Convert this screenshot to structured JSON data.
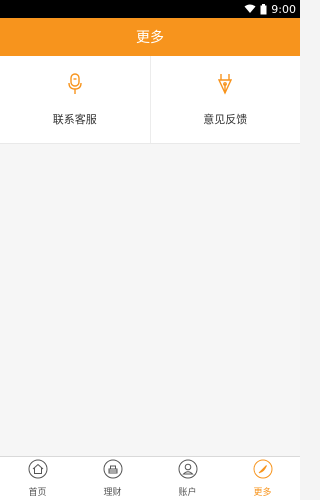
{
  "status_bar": {
    "time": "9:00"
  },
  "header": {
    "title": "更多"
  },
  "options": [
    {
      "label": "联系客服",
      "icon": "microphone-icon"
    },
    {
      "label": "意见反馈",
      "icon": "pen-nib-icon"
    }
  ],
  "tabs": [
    {
      "label": "首页",
      "icon": "home-icon",
      "active": false
    },
    {
      "label": "理财",
      "icon": "finance-icon",
      "active": false
    },
    {
      "label": "账户",
      "icon": "account-icon",
      "active": false
    },
    {
      "label": "更多",
      "icon": "more-icon",
      "active": true
    }
  ],
  "colors": {
    "accent": "#f7941d",
    "inactive_icon": "#555555"
  }
}
